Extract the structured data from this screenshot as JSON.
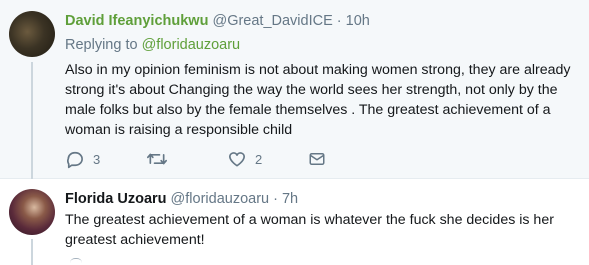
{
  "tweets": [
    {
      "author_name": "David Ifeanyichukwu",
      "handle": "@Great_DavidICE",
      "time": "· 10h",
      "replying_label": "Replying to",
      "replying_to": "@floridauzoaru",
      "text": "Also in my opinion feminism is not about making women strong,  they are already strong it's about Changing the way the world sees her strength, not only by the male folks but also by the female themselves . The greatest achievement of a woman is raising a responsible child",
      "actions": {
        "reply_count": "3",
        "retweet_count": "",
        "like_count": "2"
      }
    },
    {
      "author_name": "Florida Uzoaru",
      "handle": "@floridauzoaru",
      "time": "· 7h",
      "text": "The greatest achievement of a woman is whatever the fuck she decides is her greatest achievement!"
    }
  ],
  "colors": {
    "accent_name": "#5f9f3a",
    "muted": "#657786",
    "background_highlight": "#f5f8fa"
  },
  "icons": [
    "reply-icon",
    "retweet-icon",
    "like-icon",
    "direct-message-icon"
  ]
}
